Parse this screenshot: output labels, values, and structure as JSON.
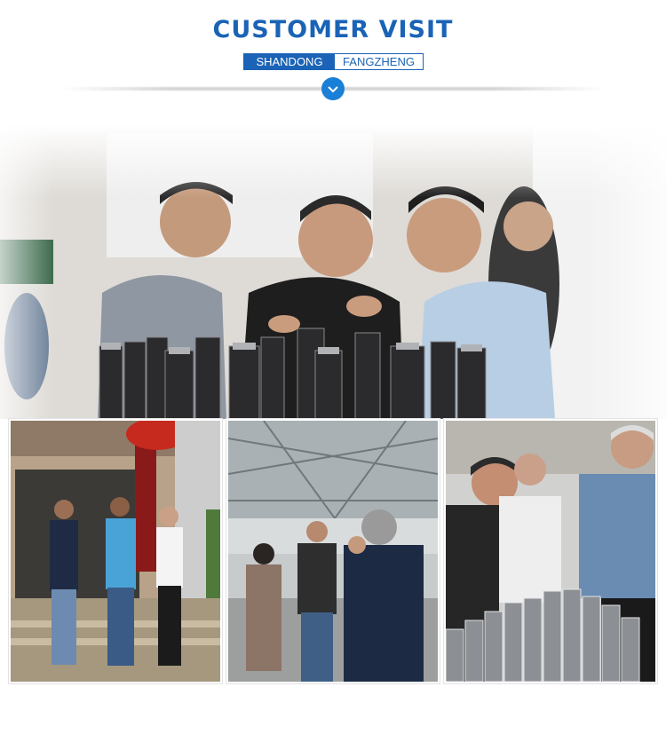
{
  "header": {
    "title": "CUSTOMER VISIT",
    "subtitle_left": "SHANDONG",
    "subtitle_right": "FANGZHENG"
  },
  "colors": {
    "brand_blue": "#1a63b6",
    "accent_blue": "#1a7fd6"
  },
  "icons": {
    "divider_icon": "chevron-down-icon"
  },
  "photos": [
    {
      "name": "hero-photo",
      "subject": "visitors inspecting steel cylinders"
    },
    {
      "name": "gate-photo",
      "subject": "three people at factory gate"
    },
    {
      "name": "workshop-photo",
      "subject": "group in factory workshop"
    },
    {
      "name": "parts-photo",
      "subject": "visitors examining metal parts"
    }
  ]
}
